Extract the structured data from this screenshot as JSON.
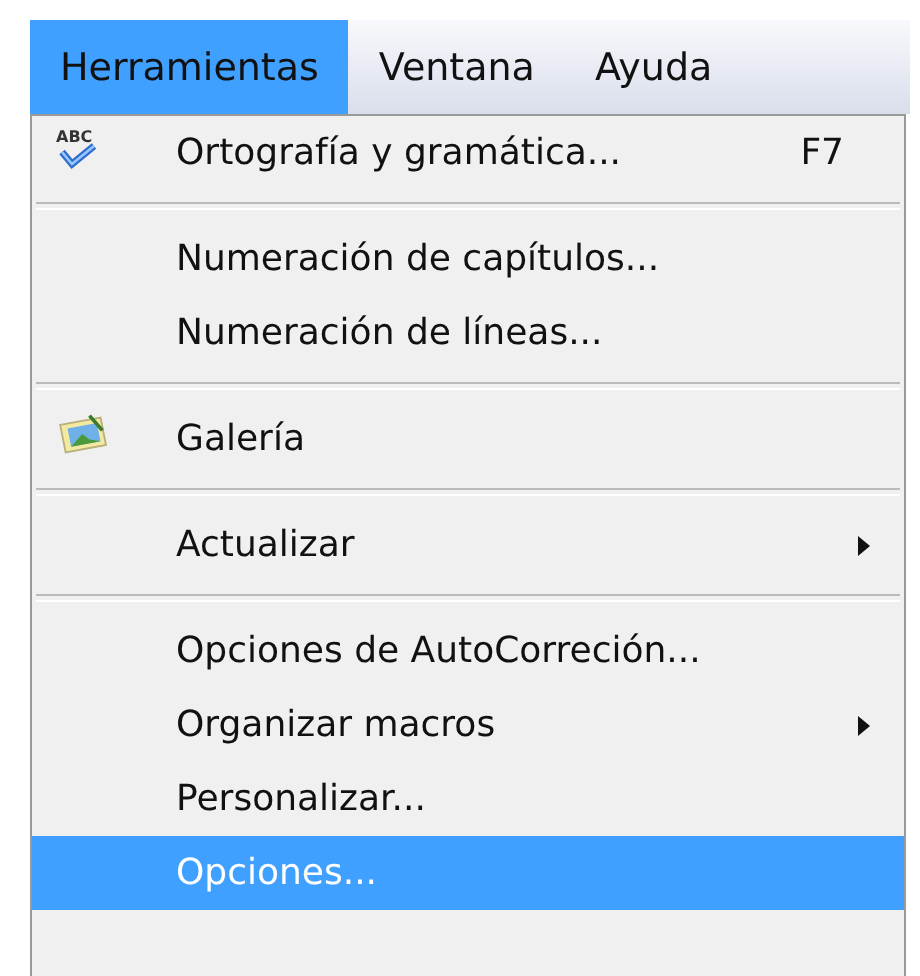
{
  "menubar": [
    {
      "label": "Herramientas",
      "selected": true
    },
    {
      "label": "Ventana",
      "selected": false
    },
    {
      "label": "Ayuda",
      "selected": false
    }
  ],
  "menu": [
    {
      "kind": "spelling",
      "icon_text": "ABC",
      "label": "Ortografía y gramática...",
      "shortcut": "F7",
      "submenu": false,
      "selected": false
    },
    {
      "kind": "separator"
    },
    {
      "kind": "item",
      "label": "Numeración de capítulos...",
      "submenu": false,
      "selected": false
    },
    {
      "kind": "item",
      "label": "Numeración de líneas...",
      "submenu": false,
      "selected": false
    },
    {
      "kind": "separator"
    },
    {
      "kind": "gallery",
      "label": "Galería",
      "submenu": false,
      "selected": false
    },
    {
      "kind": "separator"
    },
    {
      "kind": "item",
      "label": "Actualizar",
      "submenu": true,
      "selected": false
    },
    {
      "kind": "separator"
    },
    {
      "kind": "item",
      "label": "Opciones de AutoCorreción...",
      "submenu": false,
      "selected": false
    },
    {
      "kind": "item",
      "label": "Organizar macros",
      "submenu": true,
      "selected": false
    },
    {
      "kind": "item",
      "label": "Personalizar...",
      "submenu": false,
      "selected": false
    },
    {
      "kind": "item",
      "label": "Opciones...",
      "submenu": false,
      "selected": true
    }
  ]
}
